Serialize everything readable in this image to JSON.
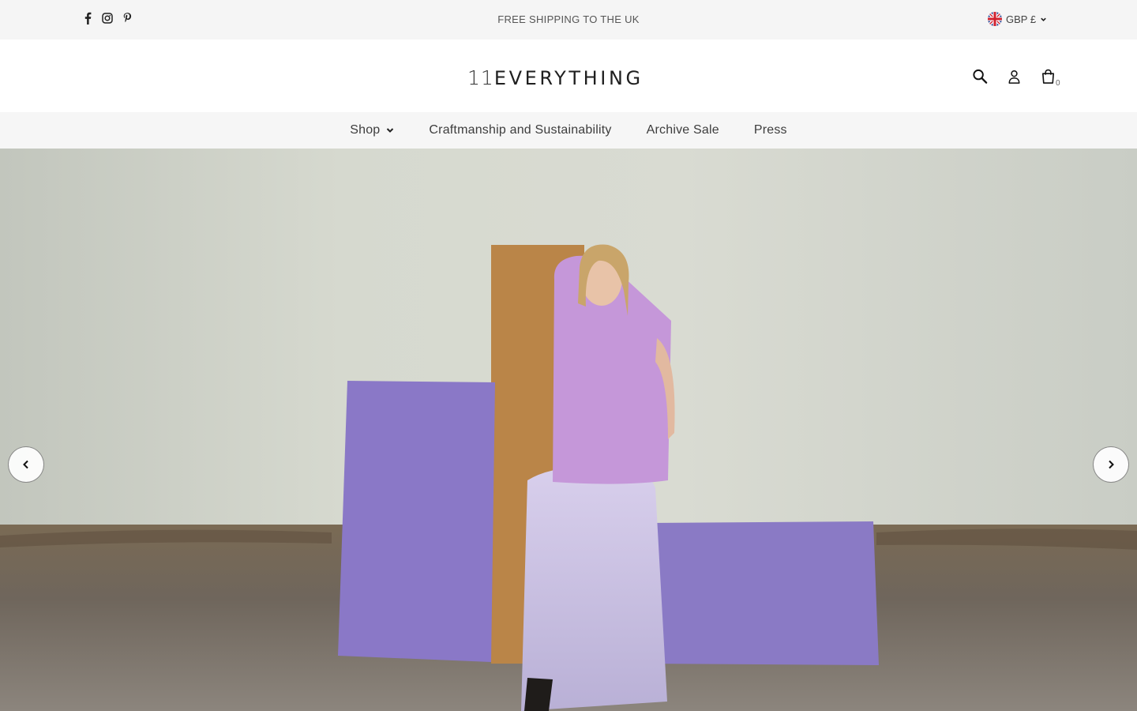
{
  "announcement": {
    "text": "FREE SHIPPING TO THE UK"
  },
  "social": {
    "icons": [
      "facebook-icon",
      "instagram-icon",
      "pinterest-icon"
    ]
  },
  "currency": {
    "label": "GBP £",
    "flag_icon": "uk-flag-icon"
  },
  "brand": {
    "logo_number": "11",
    "logo_word": "EVERYTHING"
  },
  "header_icons": {
    "search_icon": "search-icon",
    "account_icon": "user-icon",
    "cart_icon": "bag-icon",
    "cart_count": "0"
  },
  "nav": {
    "items": [
      {
        "label": "Shop",
        "has_dropdown": true
      },
      {
        "label": "Craftmanship and Sustainability",
        "has_dropdown": false
      },
      {
        "label": "Archive Sale",
        "has_dropdown": false
      },
      {
        "label": "Press",
        "has_dropdown": false
      }
    ]
  },
  "hero": {
    "prev_icon": "chevron-left-icon",
    "next_icon": "chevron-right-icon"
  },
  "colors": {
    "topbar_bg": "#f5f5f5",
    "nav_bg": "#f6f6f6",
    "text": "#3d3d3d",
    "purple_panel": "#8a78c7",
    "osb_board": "#c08b4c",
    "top_lilac": "#c597d9",
    "skirt_lilac": "#cdc3e6"
  }
}
